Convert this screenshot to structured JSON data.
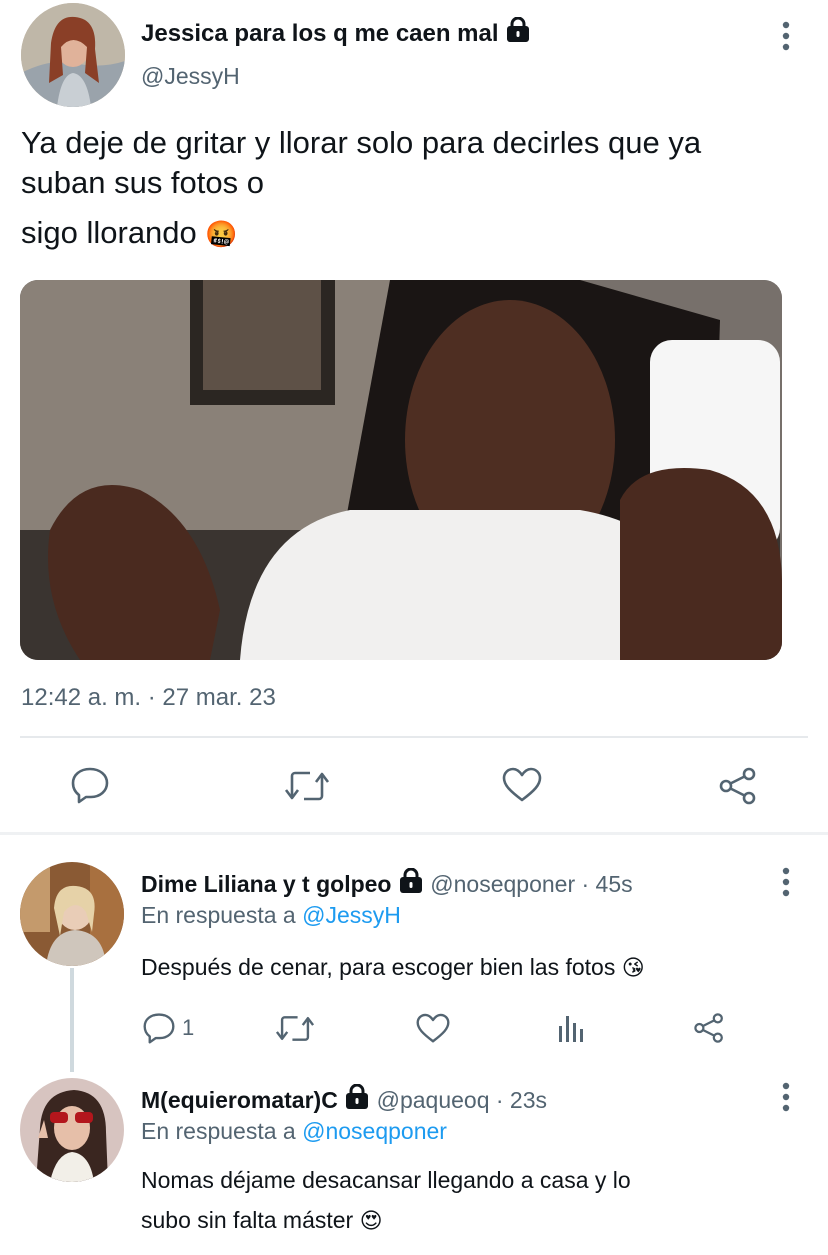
{
  "tweet": {
    "author_name": "Jessica para los q me caen mal",
    "handle": "@JessyH",
    "text_line1": "Ya deje de gritar y llorar solo para decirles que ya",
    "text_line2": "suban sus fotos o",
    "text_line3": "sigo llorando",
    "emoji": "🤬",
    "timestamp": "12:42 a. m. · 27 mar. 23"
  },
  "replies": [
    {
      "author_name": "Dime Liliana y t golpeo",
      "handle": "@noseqponer",
      "age": "· 45s",
      "replying_prefix": "En respuesta a",
      "replying_to": "@JessyH",
      "text": "Después de cenar, para escoger bien las fotos",
      "emoji": "😘",
      "reply_count": "1"
    },
    {
      "author_name": "M(equieromatar)C",
      "handle": "@paqueoq",
      "age": "· 23s",
      "replying_prefix": "En respuesta a",
      "replying_to": "@noseqponer",
      "text_line1": "Nomas déjame desacansar llegando a casa y lo",
      "text_line2": "subo sin falta máster",
      "emoji": "😍"
    }
  ],
  "colors": {
    "link": "#1d9bf0",
    "muted": "#536471",
    "icon": "#536471"
  }
}
